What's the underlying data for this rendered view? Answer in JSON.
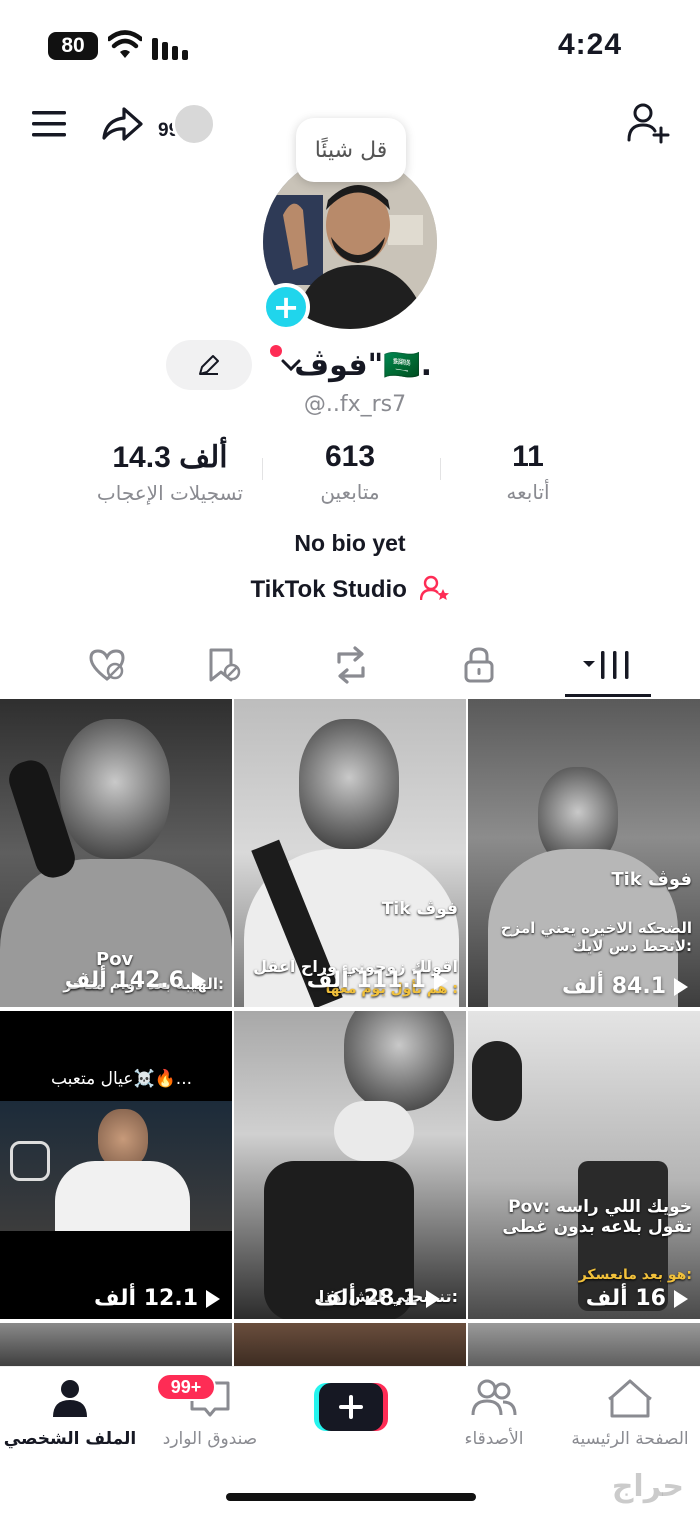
{
  "status_bar": {
    "battery": "80",
    "time": "4:24"
  },
  "header": {
    "notification_count": "99"
  },
  "profile": {
    "bubble_text": "قل شيئًا",
    "username": "فوڤ\"🇸🇦.",
    "handle": "@..fx_rs7",
    "stats": [
      {
        "value": "11",
        "label": "أتابعه"
      },
      {
        "value": "613",
        "label": "متابعين"
      },
      {
        "value": "14.3 ألف",
        "label": "تسجيلات الإعجاب"
      }
    ],
    "bio": "No bio yet",
    "studio_label": "TikTok Studio"
  },
  "videos": [
    {
      "views": "84.1 ألف",
      "caption": "الضحكه الاخيره  يعني امزح لاتحط دس لايك:",
      "tag": "Tik فوڤ"
    },
    {
      "views": "111.1 ألف",
      "caption": "اقولك زوجوني وراح اعقل",
      "subcaption": "هم بأول يوم معها :",
      "tag": "Tik فوڤ"
    },
    {
      "views": "142.6 ألف",
      "caption": "Pov",
      "subcaption": "الهيبه بعد دوام متأخر:"
    },
    {
      "views": "16 ألف",
      "caption": "Pov: خويك اللي راسه تقول بلاعه بدون غطى",
      "subcaption": "هو بعد مانعسكر:"
    },
    {
      "views": "28.1 ألف",
      "caption": "تنصحني ليش كذا:"
    },
    {
      "views": "12.1 ألف",
      "caption": "عيال متعبب☠️🔥..."
    }
  ],
  "bottom_nav": {
    "home": "الصفحة الرئيسية",
    "friends": "الأصدقاء",
    "inbox": "صندوق الوارد",
    "inbox_badge": "99+",
    "profile": "الملف الشخصي"
  },
  "watermark": "حراج"
}
